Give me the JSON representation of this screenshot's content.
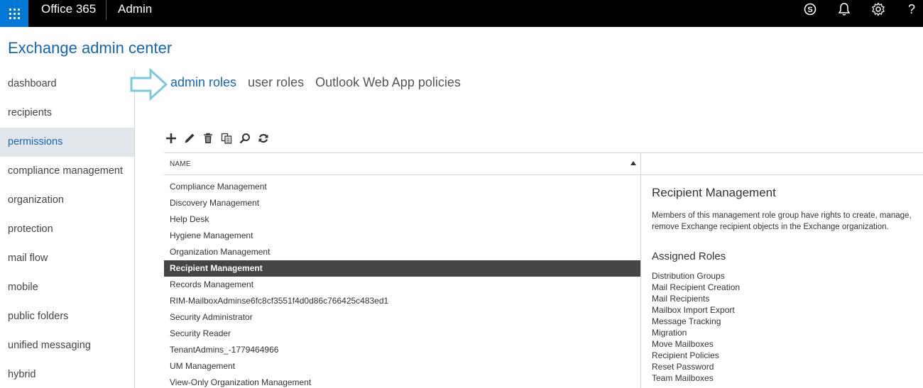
{
  "topbar": {
    "brand": "Office 365",
    "app": "Admin",
    "icons": [
      "skype-icon",
      "bell-icon",
      "gear-icon",
      "help-icon"
    ],
    "help_label": "?"
  },
  "app_title": "Exchange admin center",
  "nav": {
    "items": [
      {
        "label": "dashboard"
      },
      {
        "label": "recipients"
      },
      {
        "label": "permissions",
        "selected": true
      },
      {
        "label": "compliance management"
      },
      {
        "label": "organization"
      },
      {
        "label": "protection"
      },
      {
        "label": "mail flow"
      },
      {
        "label": "mobile"
      },
      {
        "label": "public folders"
      },
      {
        "label": "unified messaging"
      },
      {
        "label": "hybrid"
      }
    ]
  },
  "tabs": [
    {
      "label": "admin roles",
      "active": true
    },
    {
      "label": "user roles"
    },
    {
      "label": "Outlook Web App policies"
    }
  ],
  "toolbar": [
    "add-icon",
    "edit-icon",
    "delete-icon",
    "copy-icon",
    "search-icon",
    "refresh-icon"
  ],
  "list": {
    "column_header": "NAME",
    "rows": [
      "Compliance Management",
      "Discovery Management",
      "Help Desk",
      "Hygiene Management",
      "Organization Management",
      "Recipient Management",
      "Records Management",
      "RIM-MailboxAdminse6fc8cf3551f4d0d86c766425c483ed1",
      "Security Administrator",
      "Security Reader",
      "TenantAdmins_-1779464966",
      "UM Management",
      "View-Only Organization Management"
    ],
    "selected_index": 5
  },
  "detail": {
    "title": "Recipient Management",
    "description_line1": "Members of this management role group have rights to create, manage,",
    "description_line2": "remove Exchange recipient objects in the Exchange organization.",
    "assigned_roles_label": "Assigned Roles",
    "assigned_roles": [
      "Distribution Groups",
      "Mail Recipient Creation",
      "Mail Recipients",
      "Mailbox Import Export",
      "Message Tracking",
      "Migration",
      "Move Mailboxes",
      "Recipient Policies",
      "Reset Password",
      "Team Mailboxes"
    ]
  },
  "colors": {
    "accent": "#1466b5",
    "topbar": "#000000",
    "waffle": "#0078d7",
    "selected_row": "#454545",
    "selected_nav": "#e1e6ea",
    "arrow": "#7cc8dd"
  }
}
